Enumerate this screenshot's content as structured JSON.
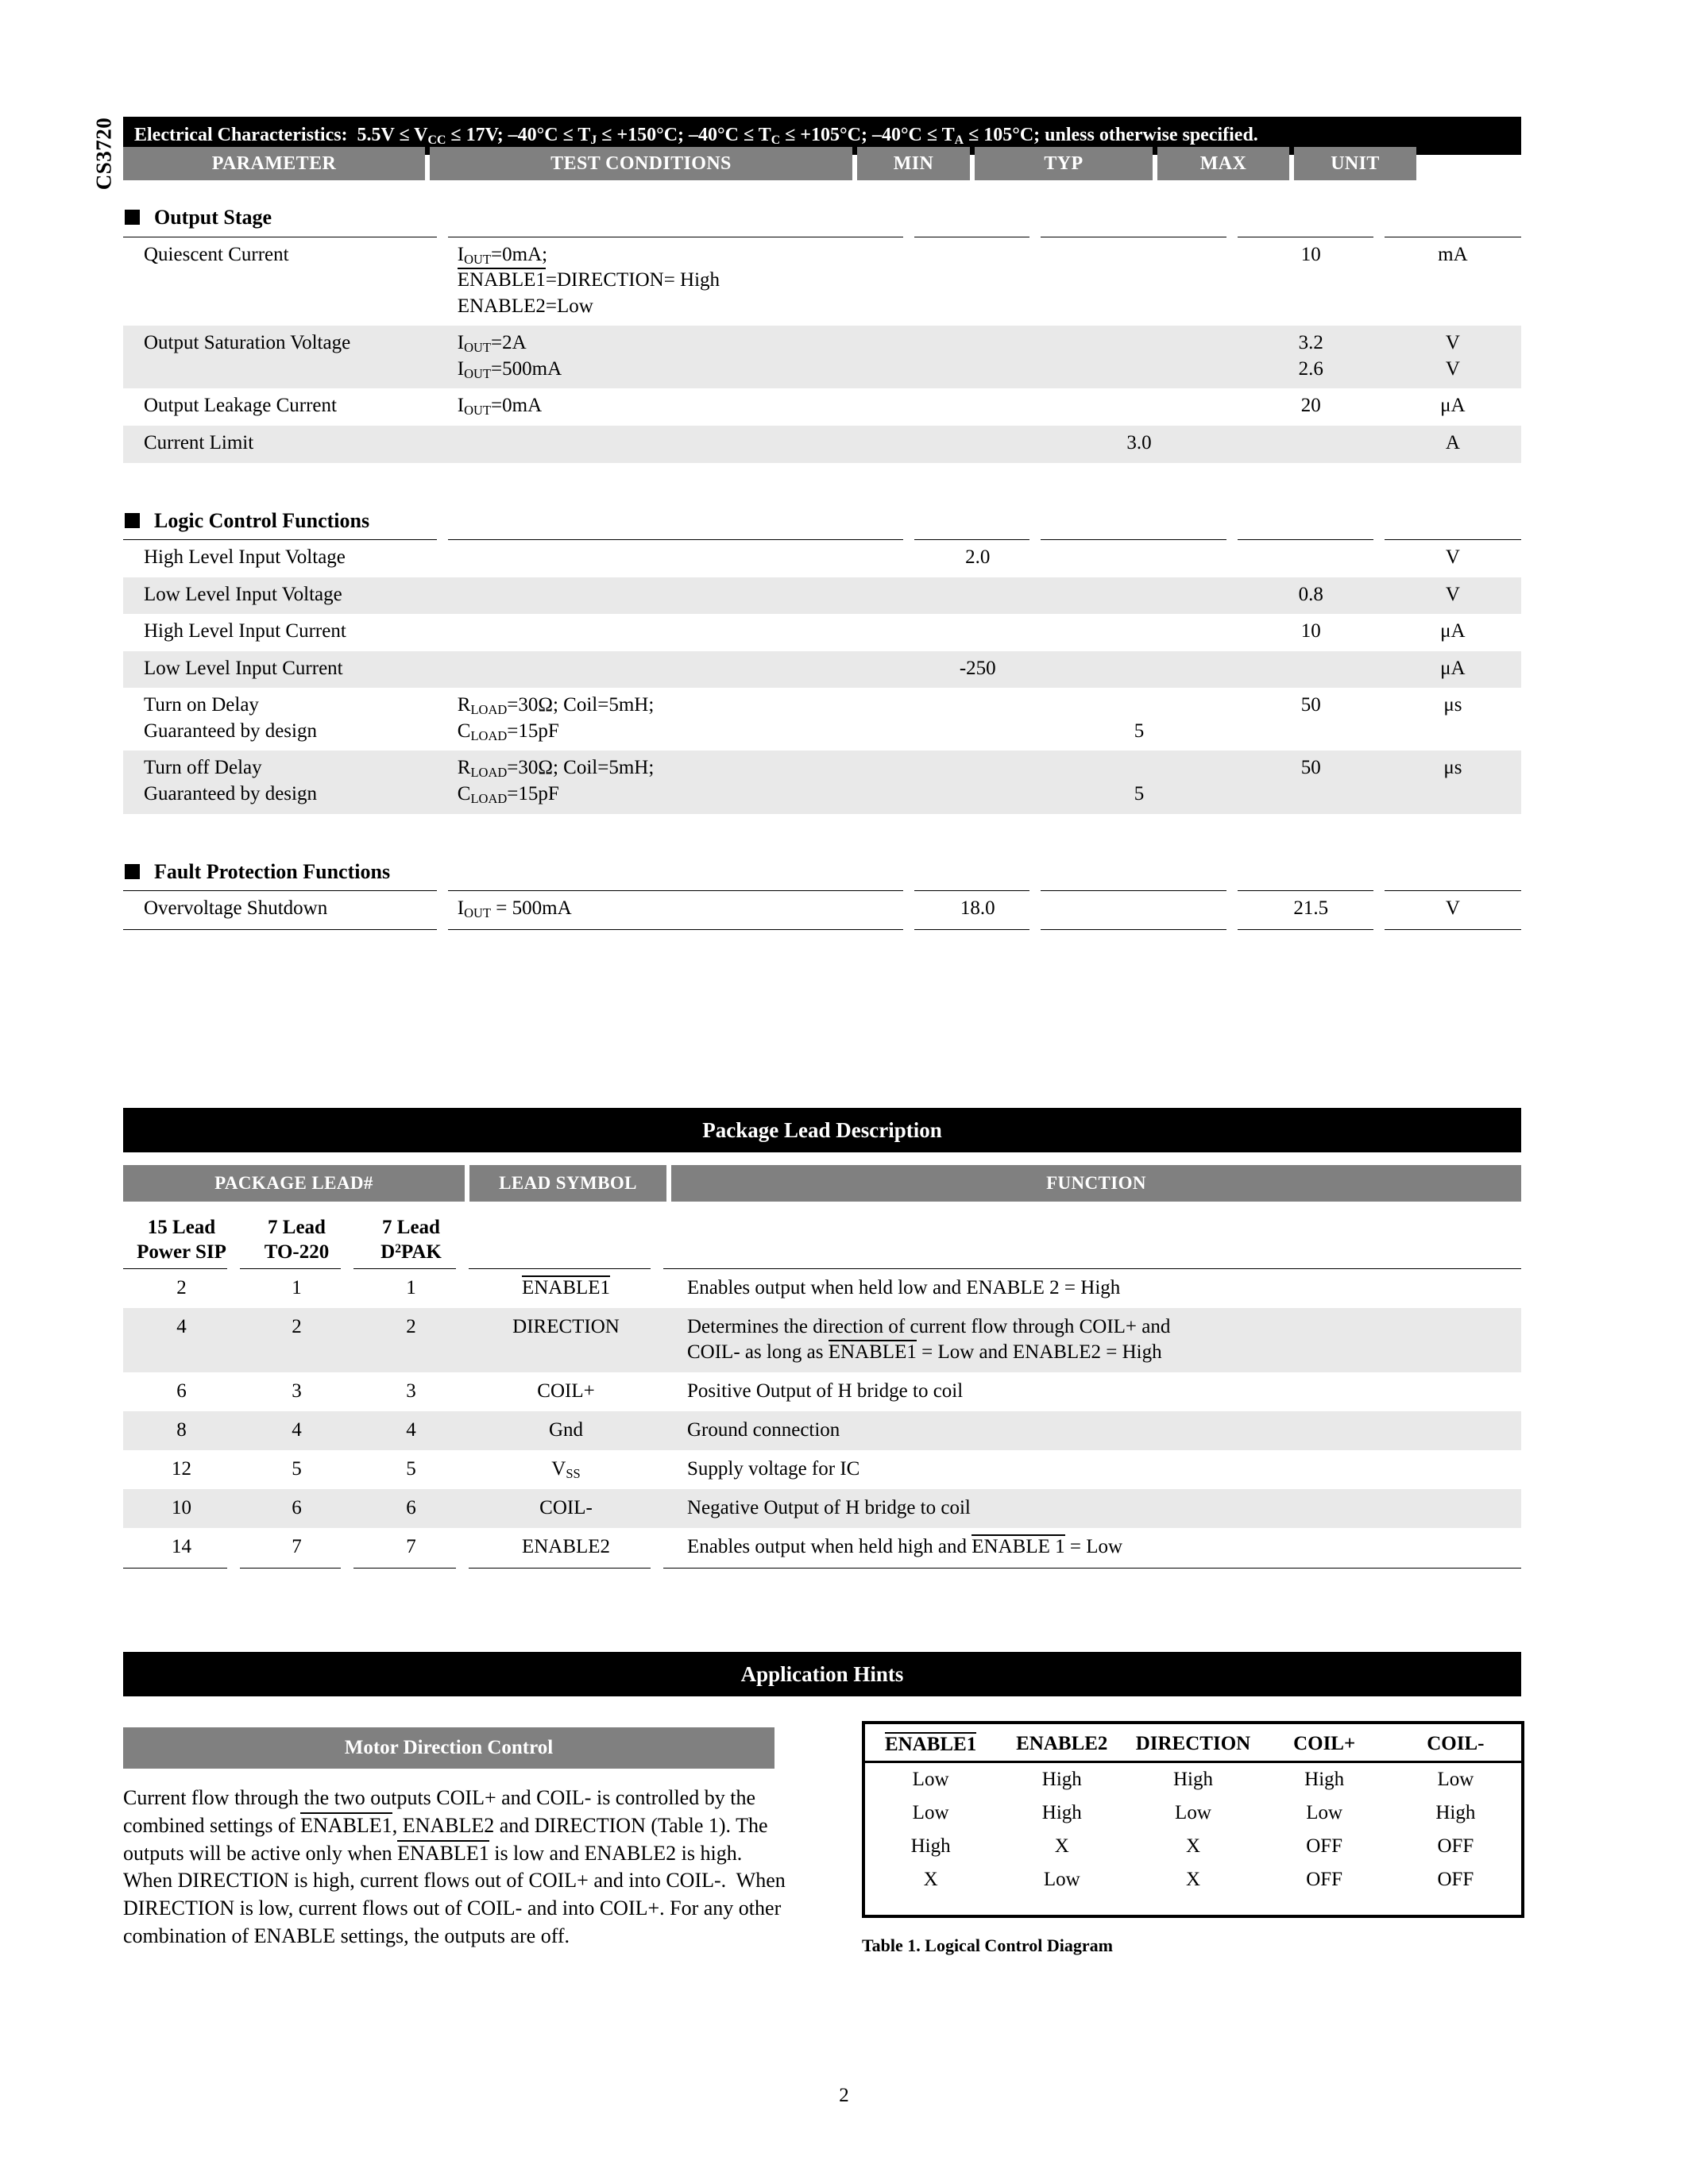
{
  "part_number": "CS3720",
  "page_number": "2",
  "electrical": {
    "header": "Electrical Characteristics:  5.5V ≤ VCC ≤ 17V; –40°C ≤ TJ ≤ +150°C; –40°C ≤ TC ≤ +105°C; –40°C ≤ TA ≤ 105°C; unless otherwise specified.",
    "columns": {
      "parameter": "PARAMETER",
      "test_conditions": "TEST CONDITIONS",
      "min": "MIN",
      "typ": "TYP",
      "max": "MAX",
      "unit": "UNIT"
    },
    "sections": [
      {
        "title": "Output Stage",
        "rows": [
          {
            "parameter": "Quiescent Current",
            "conditions_line1": "IOUT=0mA;",
            "conditions_line2": "ENABLE1=DIRECTION= High",
            "conditions_line3": "ENABLE2=Low",
            "min": "",
            "typ": "",
            "max": "10",
            "unit": "mA"
          },
          {
            "parameter": "Output Saturation Voltage",
            "conditions_line1": "IOUT=2A",
            "conditions_line2": "IOUT=500mA",
            "min": "",
            "typ": "",
            "max": "3.2",
            "max2": "2.6",
            "unit": "V",
            "unit2": "V"
          },
          {
            "parameter": "Output Leakage Current",
            "conditions_line1": "IOUT=0mA",
            "min": "",
            "typ": "",
            "max": "20",
            "unit": "μA"
          },
          {
            "parameter": "Current Limit",
            "conditions_line1": "",
            "min": "",
            "typ": "3.0",
            "max": "",
            "unit": "A"
          }
        ]
      },
      {
        "title": "Logic Control Functions",
        "rows": [
          {
            "parameter": "High Level Input Voltage",
            "conditions_line1": "",
            "min": "2.0",
            "typ": "",
            "max": "",
            "unit": "V"
          },
          {
            "parameter": "Low Level Input Voltage",
            "conditions_line1": "",
            "min": "",
            "typ": "",
            "max": "0.8",
            "unit": "V"
          },
          {
            "parameter": "High Level Input Current",
            "conditions_line1": "",
            "min": "",
            "typ": "",
            "max": "10",
            "unit": "μA"
          },
          {
            "parameter": "Low Level Input Current",
            "conditions_line1": "",
            "min": "-250",
            "typ": "",
            "max": "",
            "unit": "μA"
          },
          {
            "parameter": "Turn on Delay",
            "parameter_line2": "Guaranteed by design",
            "conditions_line1": "RLOAD=30Ω; Coil=5mH;",
            "conditions_line2": "CLOAD=15pF",
            "min": "",
            "typ": "",
            "typ2": "5",
            "max": "50",
            "unit": "μs"
          },
          {
            "parameter": "Turn off Delay",
            "parameter_line2": "Guaranteed by design",
            "conditions_line1": "RLOAD=30Ω; Coil=5mH;",
            "conditions_line2": "CLOAD=15pF",
            "min": "",
            "typ": "",
            "typ2": "5",
            "max": "50",
            "unit": "μs"
          }
        ]
      },
      {
        "title": "Fault Protection Functions",
        "rows": [
          {
            "parameter": "Overvoltage Shutdown",
            "conditions_line1": "IOUT = 500mA",
            "min": "18.0",
            "typ": "",
            "max": "21.5",
            "unit": "V"
          }
        ]
      }
    ]
  },
  "package_lead": {
    "title": "Package Lead Description",
    "group_headers": {
      "package_lead_number": "PACKAGE LEAD#",
      "lead_symbol": "LEAD SYMBOL",
      "function": "FUNCTION"
    },
    "sub_headers": [
      {
        "line1": "15 Lead",
        "line2": "Power SIP"
      },
      {
        "line1": "7 Lead",
        "line2": "TO-220"
      },
      {
        "line1": "7 Lead",
        "line2": "D2PAK"
      }
    ],
    "rows": [
      {
        "sip": "2",
        "to220": "1",
        "d2pak": "1",
        "symbol": "ENABLE1",
        "symbol_overline": true,
        "function_line1": "Enables output when held low and ENABLE 2 = High",
        "function_line2": ""
      },
      {
        "sip": "4",
        "to220": "2",
        "d2pak": "2",
        "symbol": "DIRECTION",
        "symbol_overline": false,
        "function_line1": "Determines the direction of current flow through COIL+ and",
        "function_line2": "COIL- as long as ENABLE1 = Low and ENABLE2 = High"
      },
      {
        "sip": "6",
        "to220": "3",
        "d2pak": "3",
        "symbol": "COIL+",
        "symbol_overline": false,
        "function_line1": "Positive Output of H bridge to coil",
        "function_line2": ""
      },
      {
        "sip": "8",
        "to220": "4",
        "d2pak": "4",
        "symbol": "Gnd",
        "symbol_overline": false,
        "function_line1": "Ground connection",
        "function_line2": ""
      },
      {
        "sip": "12",
        "to220": "5",
        "d2pak": "5",
        "symbol": "VSS",
        "symbol_overline": false,
        "function_line1": "Supply voltage for IC",
        "function_line2": ""
      },
      {
        "sip": "10",
        "to220": "6",
        "d2pak": "6",
        "symbol": "COIL-",
        "symbol_overline": false,
        "function_line1": "Negative Output of H bridge to coil",
        "function_line2": ""
      },
      {
        "sip": "14",
        "to220": "7",
        "d2pak": "7",
        "symbol": "ENABLE2",
        "symbol_overline": false,
        "function_line1": "Enables output when held high and ENABLE 1 = Low",
        "function_line2": ""
      }
    ]
  },
  "application_hints": {
    "title": "Application Hints",
    "motor_direction_control": {
      "heading": "Motor Direction Control",
      "paragraph": "Current flow through the two outputs COIL+ and COIL- is controlled by the combined settings of ENABLE1, ENABLE2 and DIRECTION (Table 1). The outputs will be active only when ENABLE1 is low and ENABLE2 is high. When DIRECTION is high, current flows out of COIL+ and into COIL-.  When DIRECTION is low, current flows out of COIL- and into COIL+. For any other combination of ENABLE settings, the outputs are off."
    },
    "logic_table": {
      "caption": "Table 1. Logical Control Diagram",
      "columns": [
        "ENABLE1",
        "ENABLE2",
        "DIRECTION",
        "COIL+",
        "COIL-"
      ],
      "rows": [
        [
          "Low",
          "High",
          "High",
          "High",
          "Low"
        ],
        [
          "Low",
          "High",
          "Low",
          "Low",
          "High"
        ],
        [
          "High",
          "X",
          "X",
          "OFF",
          "OFF"
        ],
        [
          "X",
          "Low",
          "X",
          "OFF",
          "OFF"
        ]
      ]
    }
  },
  "colors": {
    "bar_black": "#000000",
    "bar_grey": "#808080",
    "row_shade": "#e9e9e9"
  }
}
